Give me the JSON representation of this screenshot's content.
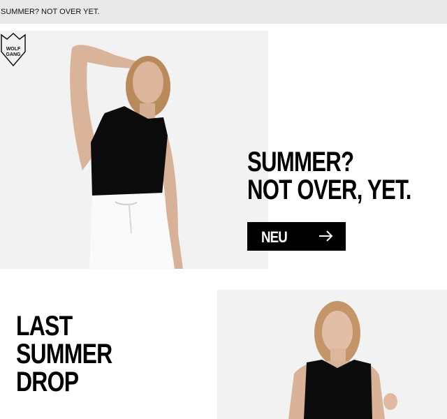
{
  "preheader": {
    "text": "SUMMER? NOT OVER YET."
  },
  "brand": {
    "logo_text_line1": "WOLF",
    "logo_text_line2": "GANG"
  },
  "hero": {
    "headline_line1": "SUMMER?",
    "headline_line2": "NOT OVER, YET.",
    "cta_label": "NEU",
    "cta_icon": "arrow-right-icon"
  },
  "section2": {
    "headline_line1": "LAST",
    "headline_line2": "SUMMER",
    "headline_line3": "DROP"
  },
  "colors": {
    "background": "#ffffff",
    "preheader_bg": "#e9e9e9",
    "text": "#000000",
    "cta_bg": "#000000",
    "cta_text": "#ffffff"
  }
}
